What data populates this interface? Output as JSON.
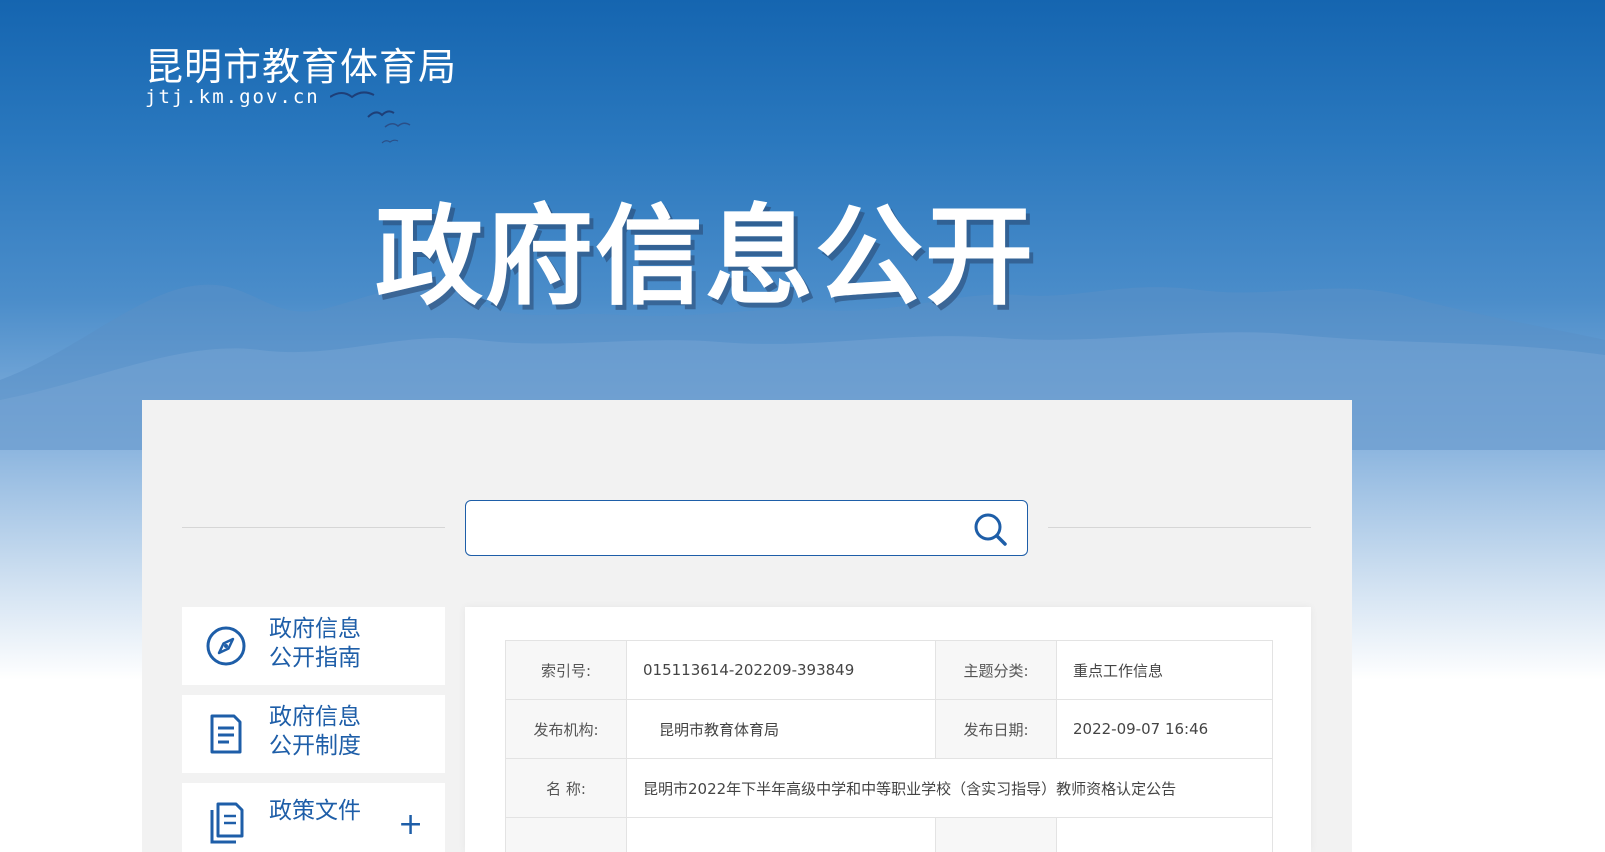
{
  "colors": {
    "primary": "#1e5ea8",
    "header_top": "#1565b0",
    "panel_bg": "#f2f2f2"
  },
  "header": {
    "org_name": "昆明市教育体育局",
    "domain": "jtj.km.gov.cn",
    "page_title": "政府信息公开"
  },
  "search": {
    "value": "",
    "placeholder": "",
    "icon": "search-icon"
  },
  "sidebar": {
    "items": [
      {
        "line1": "政府信息",
        "line2": "公开指南",
        "icon": "compass-icon"
      },
      {
        "line1": "政府信息",
        "line2": "公开制度",
        "icon": "document-icon"
      },
      {
        "line1": "政策文件",
        "line2": "",
        "icon": "files-icon",
        "expand": "+"
      }
    ]
  },
  "info_table": {
    "index_label": "索引号:",
    "index_value": "015113614-202209-393849",
    "topic_label": "主题分类:",
    "topic_value": "重点工作信息",
    "publisher_label": "发布机构:",
    "publisher_value": "昆明市教育体育局",
    "date_label": "发布日期:",
    "date_value": "2022-09-07 16:46",
    "name_label": "名 称:",
    "name_value": "昆明市2022年下半年高级中学和中等职业学校（含实习指导）教师资格认定公告"
  }
}
